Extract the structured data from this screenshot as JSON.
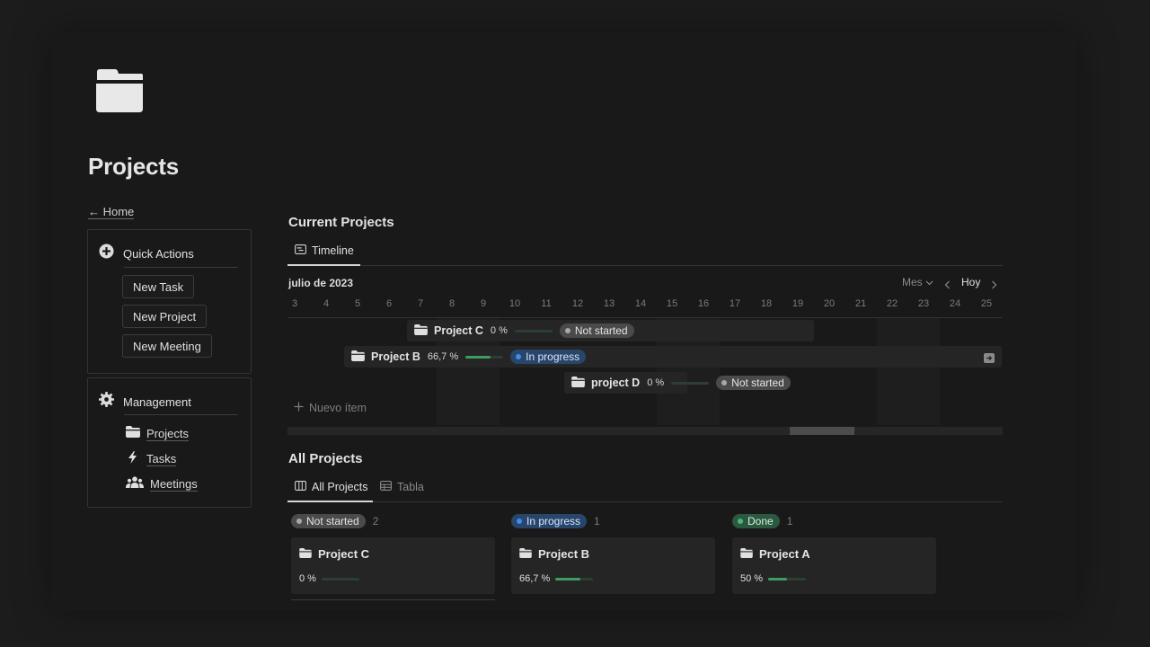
{
  "page": {
    "title": "Projects",
    "icon": "folder-icon",
    "home_link": "← Home"
  },
  "quick_actions": {
    "title": "Quick Actions",
    "icon": "plus-circle-icon",
    "buttons": [
      "New Task",
      "New Project",
      "New Meeting"
    ]
  },
  "management": {
    "title": "Management",
    "icon": "gear-icon",
    "links": [
      {
        "label": "Projects",
        "icon": "folder-icon"
      },
      {
        "label": "Tasks",
        "icon": "lightning-icon"
      },
      {
        "label": "Meetings",
        "icon": "people-icon"
      }
    ]
  },
  "current": {
    "title": "Current Projects",
    "tab": "Timeline",
    "month": "julio de 2023",
    "scale": "Mes",
    "today": "Hoy",
    "days": [
      "3",
      "4",
      "5",
      "6",
      "7",
      "8",
      "9",
      "10",
      "11",
      "12",
      "13",
      "14",
      "15",
      "16",
      "17",
      "18",
      "19",
      "20",
      "21",
      "22",
      "23",
      "24",
      "25"
    ],
    "items": [
      {
        "name": "Project C",
        "percent": "0 %",
        "progress": 0,
        "status": "Not started"
      },
      {
        "name": "Project B",
        "percent": "66,7 %",
        "progress": 0.667,
        "status": "In progress"
      },
      {
        "name": "project D",
        "percent": "0 %",
        "progress": 0,
        "status": "Not started"
      }
    ],
    "new_item": "Nuevo ítem"
  },
  "all": {
    "title": "All Projects",
    "tabs": [
      "All Projects",
      "Tabla"
    ],
    "columns": [
      {
        "status": "Not started",
        "count": "2",
        "card": {
          "name": "Project C",
          "percent": "0 %",
          "progress": 0
        }
      },
      {
        "status": "In progress",
        "count": "1",
        "card": {
          "name": "Project B",
          "percent": "66,7 %",
          "progress": 0.667
        }
      },
      {
        "status": "Done",
        "count": "1",
        "card": {
          "name": "Project A",
          "percent": "50 %",
          "progress": 0.5
        }
      }
    ]
  },
  "colors": {
    "background": "#191919",
    "not_started": "#4a4a4a",
    "in_progress": "#28456c",
    "done": "#2b5940",
    "progress_fill": "#3e9b62"
  }
}
